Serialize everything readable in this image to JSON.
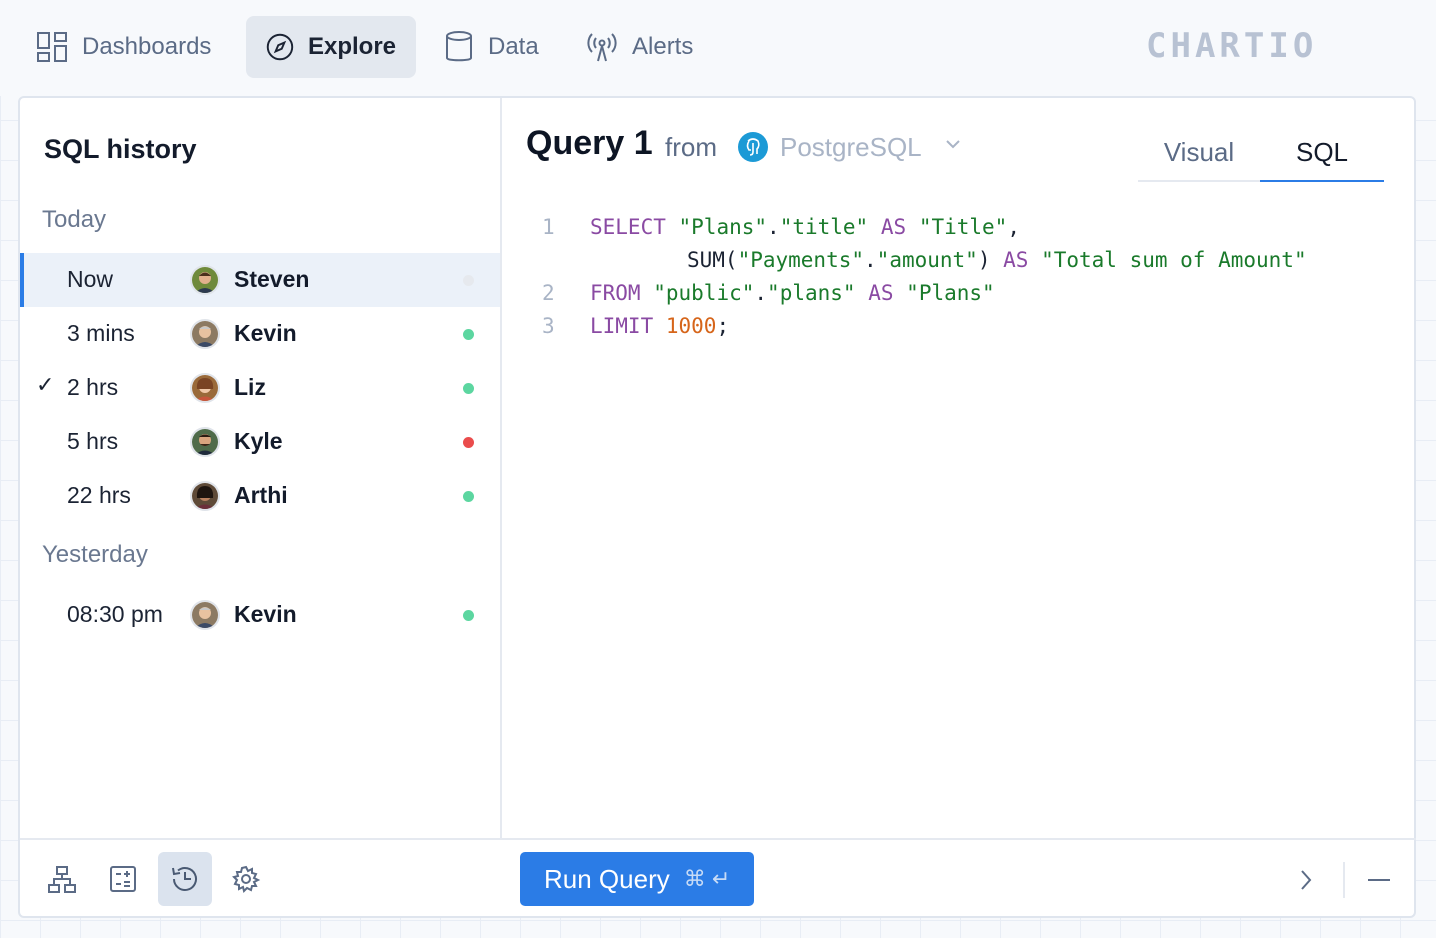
{
  "nav": {
    "items": [
      {
        "label": "Dashboards",
        "icon": "dashboards-icon",
        "active": false
      },
      {
        "label": "Explore",
        "icon": "compass-icon",
        "active": true
      },
      {
        "label": "Data",
        "icon": "database-icon",
        "active": false
      },
      {
        "label": "Alerts",
        "icon": "antenna-icon",
        "active": false
      }
    ],
    "logo": "CHARTIO"
  },
  "sidebar": {
    "title": "SQL history",
    "groups": [
      {
        "label": "Today"
      },
      {
        "label": "Yesterday"
      }
    ],
    "rows": [
      {
        "time": "Now",
        "user": "Steven",
        "status": "pending",
        "checked": false,
        "selected": true
      },
      {
        "time": "3 mins",
        "user": "Kevin",
        "status": "success",
        "checked": false,
        "selected": false
      },
      {
        "time": "2 hrs",
        "user": "Liz",
        "status": "success",
        "checked": true,
        "selected": false
      },
      {
        "time": "5 hrs",
        "user": "Kyle",
        "status": "error",
        "checked": false,
        "selected": false
      },
      {
        "time": "22 hrs",
        "user": "Arthi",
        "status": "success",
        "checked": false,
        "selected": false
      },
      {
        "time": "08:30 pm",
        "user": "Kevin",
        "status": "success",
        "checked": false,
        "selected": false
      }
    ],
    "check_glyph": "✓"
  },
  "editor": {
    "query_title": "Query 1",
    "from_label": "from",
    "source": "PostgreSQL",
    "tabs": [
      "Visual",
      "SQL"
    ],
    "active_tab": "SQL",
    "code": {
      "line_numbers": [
        "1",
        "2",
        "3"
      ],
      "l1_select": "SELECT",
      "l1_plans": "\"Plans\"",
      "dot": ".",
      "l1_title": "\"title\"",
      "as": "AS",
      "l1_alias": "\"Title\"",
      "comma": ",",
      "l1b_sum": "SUM(",
      "l1b_payments": "\"Payments\"",
      "l1b_amount": "\"amount\"",
      "l1b_close": ")",
      "l1b_alias": "\"Total sum of Amount\"",
      "l2_from": "FROM",
      "l2_public": "\"public\"",
      "l2_plans": "\"plans\"",
      "l2_alias": "\"Plans\"",
      "l3_limit": "LIMIT",
      "l3_num": "1000",
      "semicolon": ";"
    }
  },
  "footer": {
    "tools": [
      "schema-icon",
      "calculator-icon",
      "history-icon",
      "settings-icon"
    ],
    "active_tool": "history-icon",
    "run_label": "Run Query",
    "run_shortcut": "⌘ ↵"
  },
  "colors": {
    "accent": "#2b7ce6",
    "success": "#5cd6a0",
    "error": "#ea4c4c",
    "pending": "#e6e9ee"
  }
}
